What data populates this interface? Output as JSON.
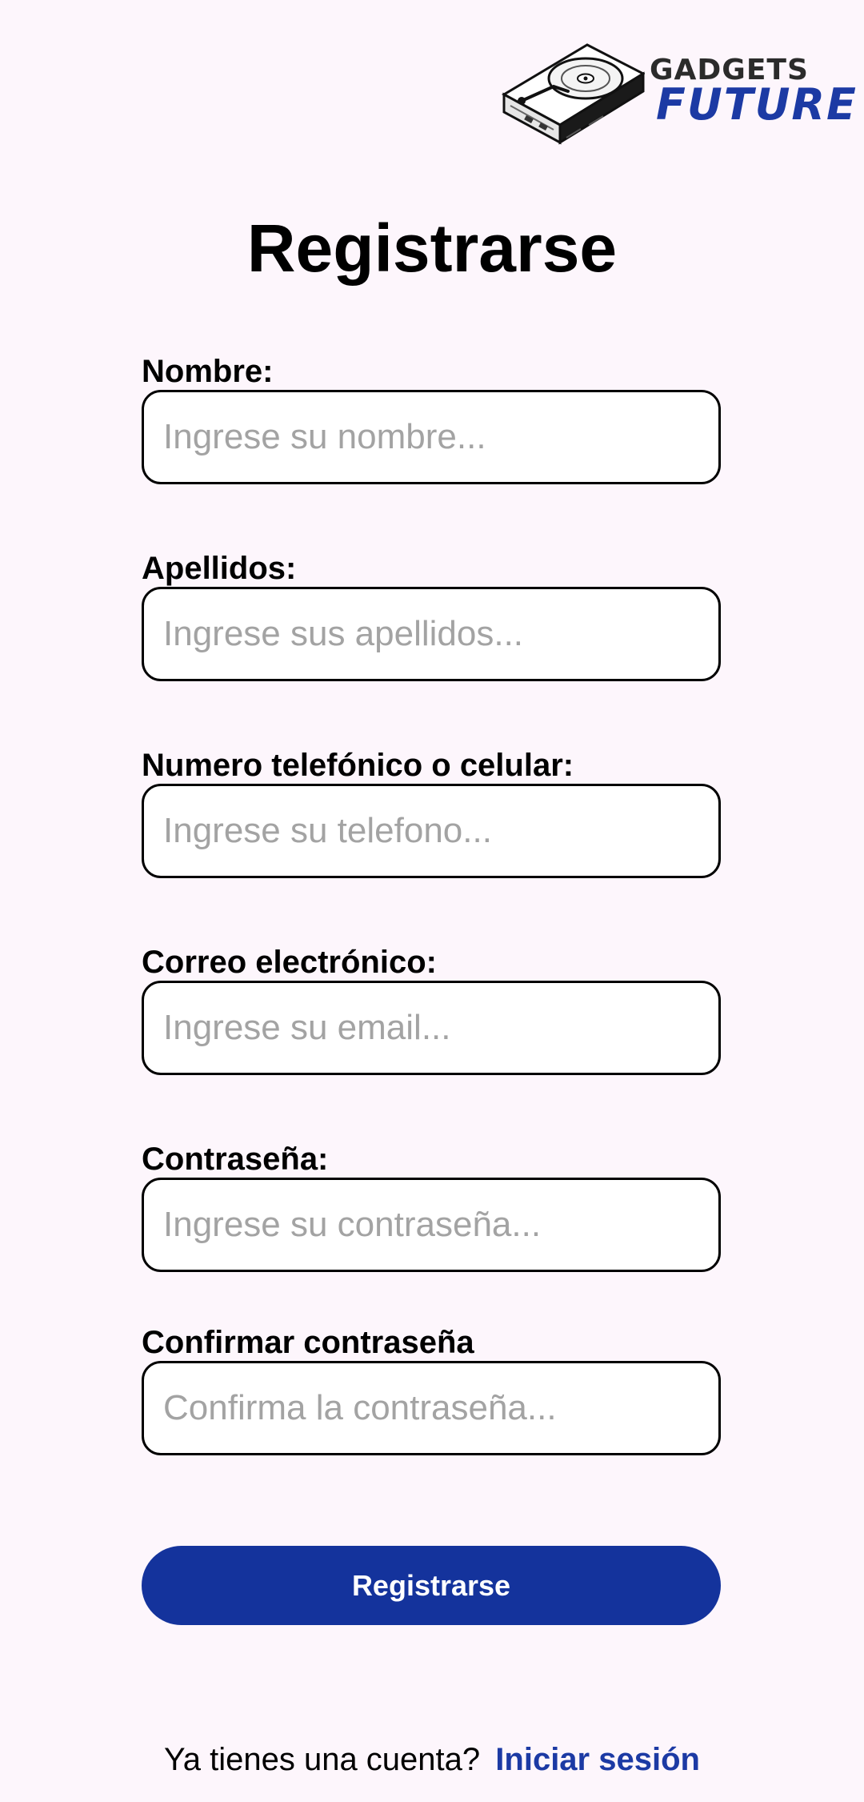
{
  "logo": {
    "line1": "GADGETS",
    "line2": "FUTURE",
    "icon": "hard-drive-icon"
  },
  "title": "Registrarse",
  "fields": [
    {
      "label": "Nombre:",
      "placeholder": "Ingrese su nombre...",
      "value": ""
    },
    {
      "label": "Apellidos:",
      "placeholder": "Ingrese sus apellidos...",
      "value": ""
    },
    {
      "label": "Numero telefónico o celular:",
      "placeholder": "Ingrese su telefono...",
      "value": ""
    },
    {
      "label": "Correo electrónico:",
      "placeholder": "Ingrese su email...",
      "value": ""
    },
    {
      "label": "Contraseña:",
      "placeholder": "Ingrese su contraseña...",
      "value": ""
    },
    {
      "label": "Confirmar contraseña",
      "placeholder": "Confirma la contraseña...",
      "value": ""
    }
  ],
  "register_button": "Registrarse",
  "login_prompt": {
    "text": "Ya tienes una cuenta?",
    "link": "Iniciar sesión"
  },
  "colors": {
    "background": "#fdf6fc",
    "accent": "#14339c",
    "link": "#1c3aa4"
  }
}
